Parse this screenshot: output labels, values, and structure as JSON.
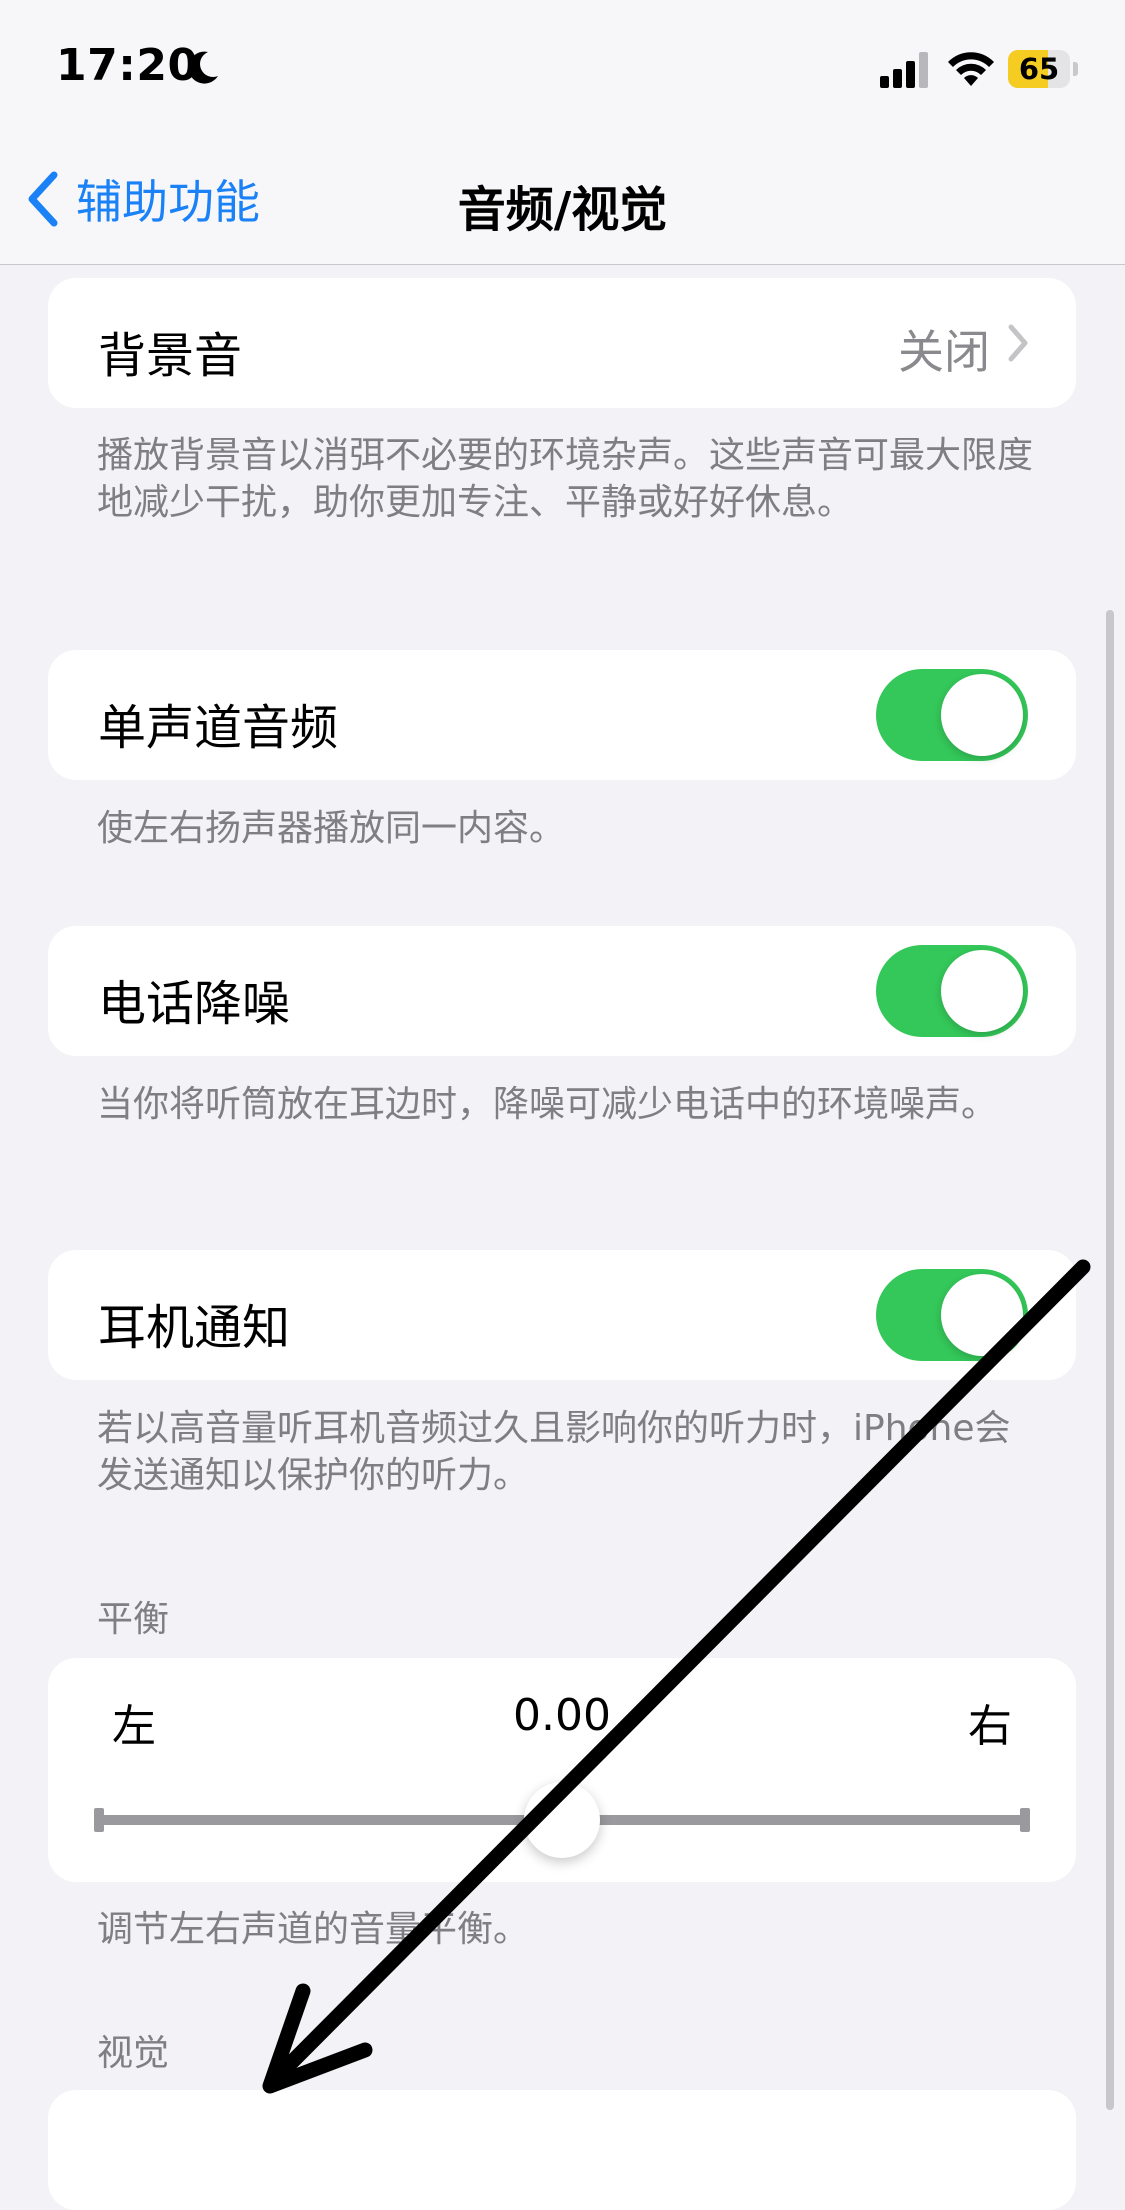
{
  "status_bar": {
    "time": "17:20",
    "battery_percent": "65",
    "battery_level": 0.65,
    "icons": [
      "moon-icon",
      "cellular-signal-icon",
      "wifi-icon",
      "battery-icon"
    ]
  },
  "nav": {
    "back_label": "辅助功能",
    "title": "音频/视觉"
  },
  "background_sounds": {
    "label": "背景音",
    "value": "关闭",
    "footnote": "播放背景音以消弭不必要的环境杂声。这些声音可最大限度地减少干扰，助你更加专注、平静或好好休息。"
  },
  "mono_audio": {
    "label": "单声道音频",
    "enabled": true,
    "footnote": "使左右扬声器播放同一内容。"
  },
  "phone_noise_cancellation": {
    "label": "电话降噪",
    "enabled": true,
    "footnote": "当你将听筒放在耳边时，降噪可减少电话中的环境噪声。"
  },
  "headphone_notifications": {
    "label": "耳机通知",
    "enabled": true,
    "footnote": "若以高音量听耳机音频过久且影响你的听力时，iPhone会发送通知以保护你的听力。"
  },
  "balance": {
    "header": "平衡",
    "left_label": "左",
    "right_label": "右",
    "value": "0.00",
    "position": 0.5,
    "footnote": "调节左右声道的音量平衡。"
  },
  "visual": {
    "header": "视觉"
  },
  "colors": {
    "accent_blue": "#1a82f6",
    "toggle_on": "#34c759",
    "battery": "#f5cc22",
    "background": "#f2f2f7"
  }
}
